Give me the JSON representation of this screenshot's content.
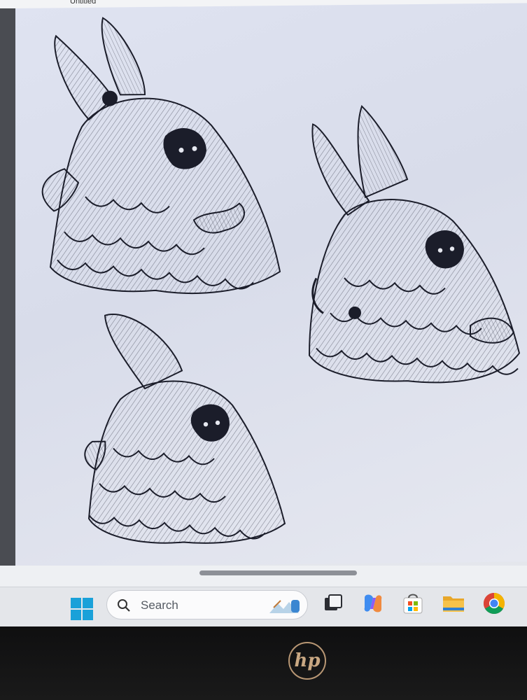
{
  "window": {
    "title": "Untitled"
  },
  "canvas": {
    "content": "sketch-drawing-three-fluffy-creatures"
  },
  "taskbar": {
    "search": {
      "label": "Search"
    },
    "apps": [
      {
        "name": "task-view",
        "icon": "task-view-icon"
      },
      {
        "name": "copilot",
        "icon": "copilot-icon"
      },
      {
        "name": "microsoft-store",
        "icon": "store-icon"
      },
      {
        "name": "file-explorer",
        "icon": "folder-icon"
      },
      {
        "name": "chrome",
        "icon": "chrome-icon"
      }
    ]
  },
  "bezel": {
    "brand": "hp"
  },
  "colors": {
    "canvas_bg": "#dde1ef",
    "ink": "#1b1d2a",
    "taskbar": "#e4e6ea",
    "hp_gold": "#c9a883"
  }
}
